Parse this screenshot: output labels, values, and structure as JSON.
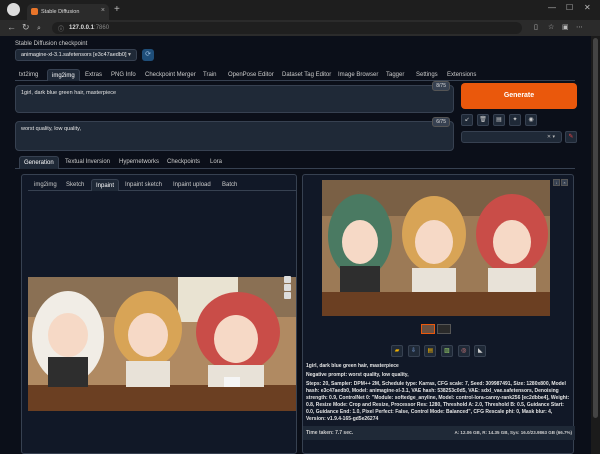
{
  "browser": {
    "tab_title": "Stable Diffusion",
    "url_host": "127.0.0.1",
    "url_port": ":7860",
    "new_tab": "+"
  },
  "checkpoint": {
    "label": "Stable Diffusion checkpoint",
    "value": "animagine-xl-3.1.safetensors [e3c47aedb0]"
  },
  "main_tabs": [
    "txt2img",
    "img2img",
    "Extras",
    "PNG Info",
    "Checkpoint Merger",
    "Train",
    "OpenPose Editor",
    "Dataset Tag Editor",
    "Image Browser",
    "Tagger",
    "Settings",
    "Extensions"
  ],
  "prompt": {
    "text": "1girl, dark blue green hair, masterpiece",
    "count": "8/75"
  },
  "negative_prompt": {
    "text": "worst quality, low quality,",
    "count": "6/75"
  },
  "generate_label": "Generate",
  "sub_tabs": [
    "Generation",
    "Textual Inversion",
    "Hypernetworks",
    "Checkpoints",
    "Lora"
  ],
  "img_tabs": [
    "img2img",
    "Sketch",
    "Inpaint",
    "Inpaint sketch",
    "Inpaint upload",
    "Batch"
  ],
  "output": {
    "info_prompt": "1girl, dark blue green hair, masterpiece",
    "info_negative": "Negative prompt: worst quality, low quality,",
    "info_params": "Steps: 20, Sampler: DPM++ 2M, Schedule type: Karras, CFG scale: 7, Seed: 309987491, Size: 1280x800, Model hash: e3c47aedb0, Model: animagine-xl-3.1, VAE hash: 538253c0d5, VAE: sdxl_vae.safetensors, Denoising strength: 0.9, ControlNet 0: \"Module: softedge_anyline, Model: control-lora-canny-rank256 [ec2dbbe4], Weight: 0.8, Resize Mode: Crop and Resize, Processor Res: 1280, Threshold A: 2.0, Threshold B: 0.5, Guidance Start: 0.0, Guidance End: 1.0, Pixel Perfect: False, Control Mode: Balanced\", CFG Rescale phi: 0, Mask blur: 4, Version: v1.9.4-165-gd5e26274",
    "time_taken": "Time taken: 7.7 sec.",
    "vram": "A: 12.06 GB, R: 14.35 GB, Sys: 16.0/23.9863 GB (66.7%)"
  },
  "colors": {
    "accent": "#ea580c",
    "background": "#0b0f19",
    "panel": "#1f2937"
  }
}
